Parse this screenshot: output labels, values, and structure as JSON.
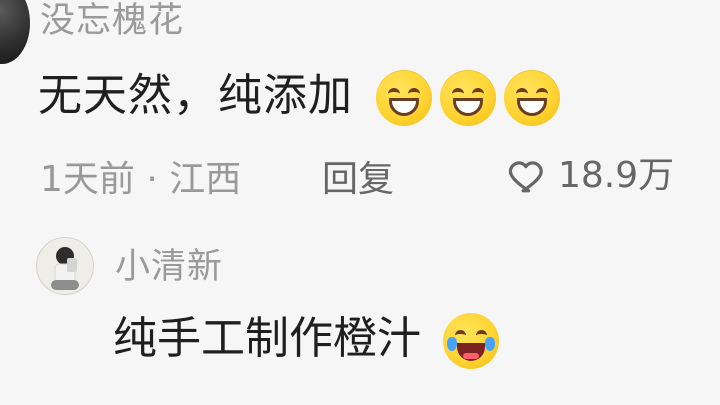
{
  "top_comment": {
    "username": "没忘槐花",
    "content": "无天然，纯添加",
    "meta": "1天前 · 江西",
    "reply_label": "回复",
    "likes": "18.9万",
    "emoji_icon": "grinning-face-icon"
  },
  "reply_comment": {
    "username": "小清新",
    "content": "纯手工制作橙汁",
    "emoji_icon": "face-with-tears-of-joy-icon"
  },
  "colors": {
    "background": "#f6f6f6",
    "primary_text": "#1f1f1f",
    "secondary_text": "#999999",
    "emoji_yellow": "#ffd433"
  }
}
